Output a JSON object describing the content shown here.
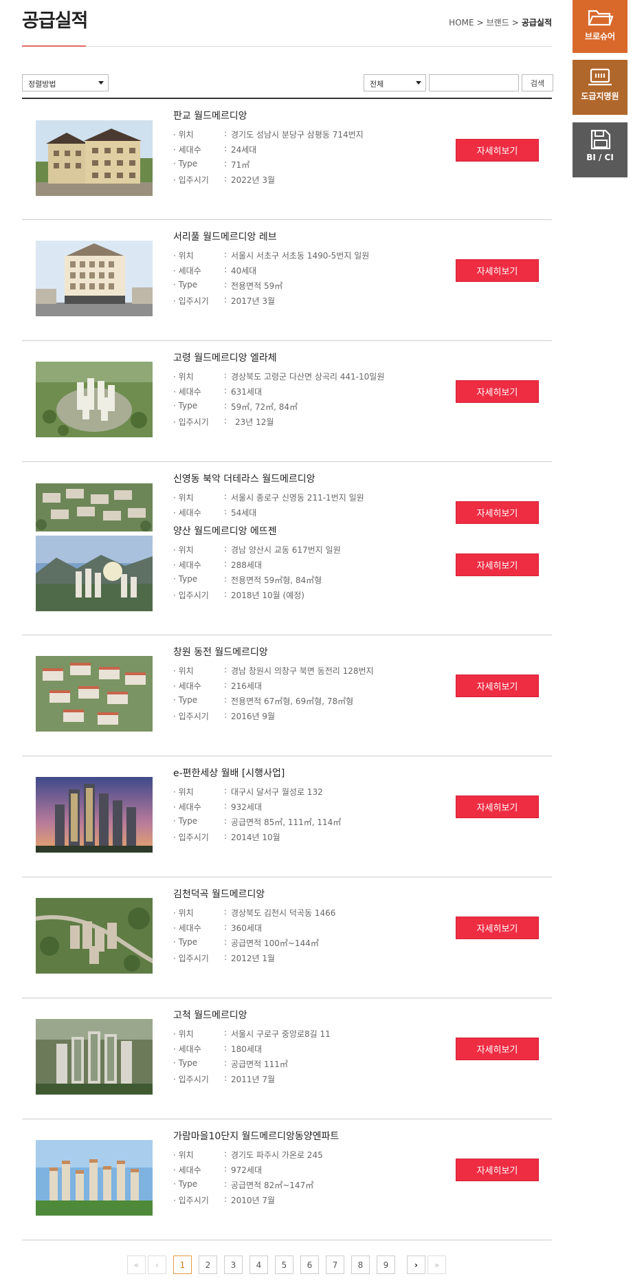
{
  "header": {
    "title": "공급실적",
    "breadcrumb": {
      "home": "HOME",
      "sep": ">",
      "parent": "브랜드",
      "current": "공급실적"
    }
  },
  "filters": {
    "sort_value": "정렬방법",
    "category_value": "전체",
    "search_value": "",
    "search_label": "검색"
  },
  "labels": {
    "location": "· 위치",
    "households": "· 세대수",
    "type": "· Type",
    "move_in": "· 입주시기",
    "colon": ":",
    "detail": "자세히보기"
  },
  "items": [
    {
      "title": "판교 월드메르디앙",
      "location": "경기도 성남시 분당구 삼평동 714번지",
      "households": "24세대",
      "type": "71㎡",
      "move_in": "2022년 3월"
    },
    {
      "title": "서리풀 월드메르디앙 레브",
      "location": "서울시 서초구 서초동 1490-5번지 일원",
      "households": "40세대",
      "type": "전용면적 59㎡",
      "move_in": "2017년 3월"
    },
    {
      "title": "고령 월드메르디앙 엘라체",
      "location": "경상북도 고령군 다산면 상곡리 441-10일원",
      "households": "631세대",
      "type": "59㎡, 72㎡, 84㎡",
      "move_in": "23년 12월"
    },
    {
      "title": "신영동 북악 더테라스 월드메르디앙",
      "location": "서울시 종로구 신영동 211-1번지 일원",
      "households": "54세대"
    },
    {
      "title": "양산 월드메르디앙 에뜨젠",
      "location": "경남 양산시 교동 617번지 일원",
      "households": "288세대",
      "type": "전용면적 59㎡형, 84㎡형",
      "move_in": "2018년 10월 (예정)"
    },
    {
      "title": "창원 동전 월드메르디앙",
      "location": "경남 창원시 의창구 북면 동전리 128번지",
      "households": "216세대",
      "type": "전용면적 67㎡형, 69㎡형, 78㎡형",
      "move_in": "2016년 9월"
    },
    {
      "title": "e-편한세상 월배 [시행사업]",
      "location": "대구시 달서구 월성로 132",
      "households": "932세대",
      "type": "공급면적 85㎡, 111㎡, 114㎡",
      "move_in": "2014년 10월"
    },
    {
      "title": "김천덕곡 월드메르디앙",
      "location": "경상북도 김천시 덕곡동 1466",
      "households": "360세대",
      "type": "공급면적 100㎡~144㎡",
      "move_in": "2012년 1월"
    },
    {
      "title": "고척 월드메르디앙",
      "location": "서울시 구로구 중앙로8길 11",
      "households": "180세대",
      "type": "공급면적 111㎡",
      "move_in": "2011년 7월"
    },
    {
      "title": "가람마을10단지 월드메르디앙동양엔파트",
      "location": "경기도 파주시 가온로 245",
      "households": "972세대",
      "type": "공급면적 82㎡~147㎡",
      "move_in": "2010년 7월"
    }
  ],
  "pagination": {
    "first": "«",
    "prev": "‹",
    "pages": [
      "1",
      "2",
      "3",
      "4",
      "5",
      "6",
      "7",
      "8",
      "9"
    ],
    "current": "1",
    "next": "›",
    "last": "»"
  },
  "quick_menu": {
    "brochure": "브로슈어",
    "directory": "도급지명원",
    "bici": "BI / CI"
  },
  "colors": {
    "accent_red": "#ee2d43",
    "brochure_bg": "#d9692b",
    "directory_bg": "#b0672b",
    "bici_bg": "#5a5a5a",
    "active_page": "#e39a3e"
  }
}
